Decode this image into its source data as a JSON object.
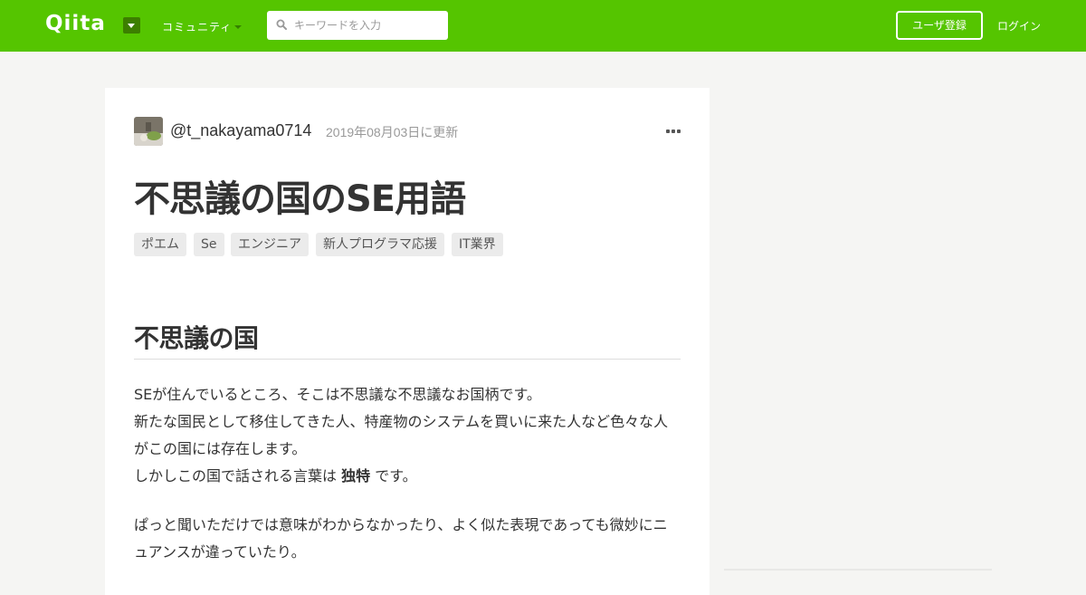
{
  "header": {
    "logo": "Qiita",
    "community_label": "コミュニティ",
    "search_placeholder": "キーワードを入力",
    "signup_label": "ユーザ登録",
    "login_label": "ログイン",
    "brand_color": "#55c500"
  },
  "article": {
    "author": "@t_nakayama0714",
    "updated": "2019年08月03日に更新",
    "title": "不思議の国のSE用語",
    "tags": [
      "ポエム",
      "Se",
      "エンジニア",
      "新人プログラマ応援",
      "IT業界"
    ],
    "section_heading": "不思議の国",
    "p1_line1": "SEが住んでいるところ、そこは不思議な不思議なお国柄です。",
    "p1_line2": "新たな国民として移住してきた人、特産物のシステムを買いに来た人など色々な人",
    "p1_line3": "がこの国には存在します。",
    "p1_line4_prefix": "しかしこの国で話される言葉は",
    "p1_line4_strong": "独特",
    "p1_line4_suffix": "です。",
    "p2_line1": "ぱっと聞いただけでは意味がわからなかったり、よく似た表現であっても微妙にニ",
    "p2_line2": "ュアンスが違っていたり。"
  }
}
